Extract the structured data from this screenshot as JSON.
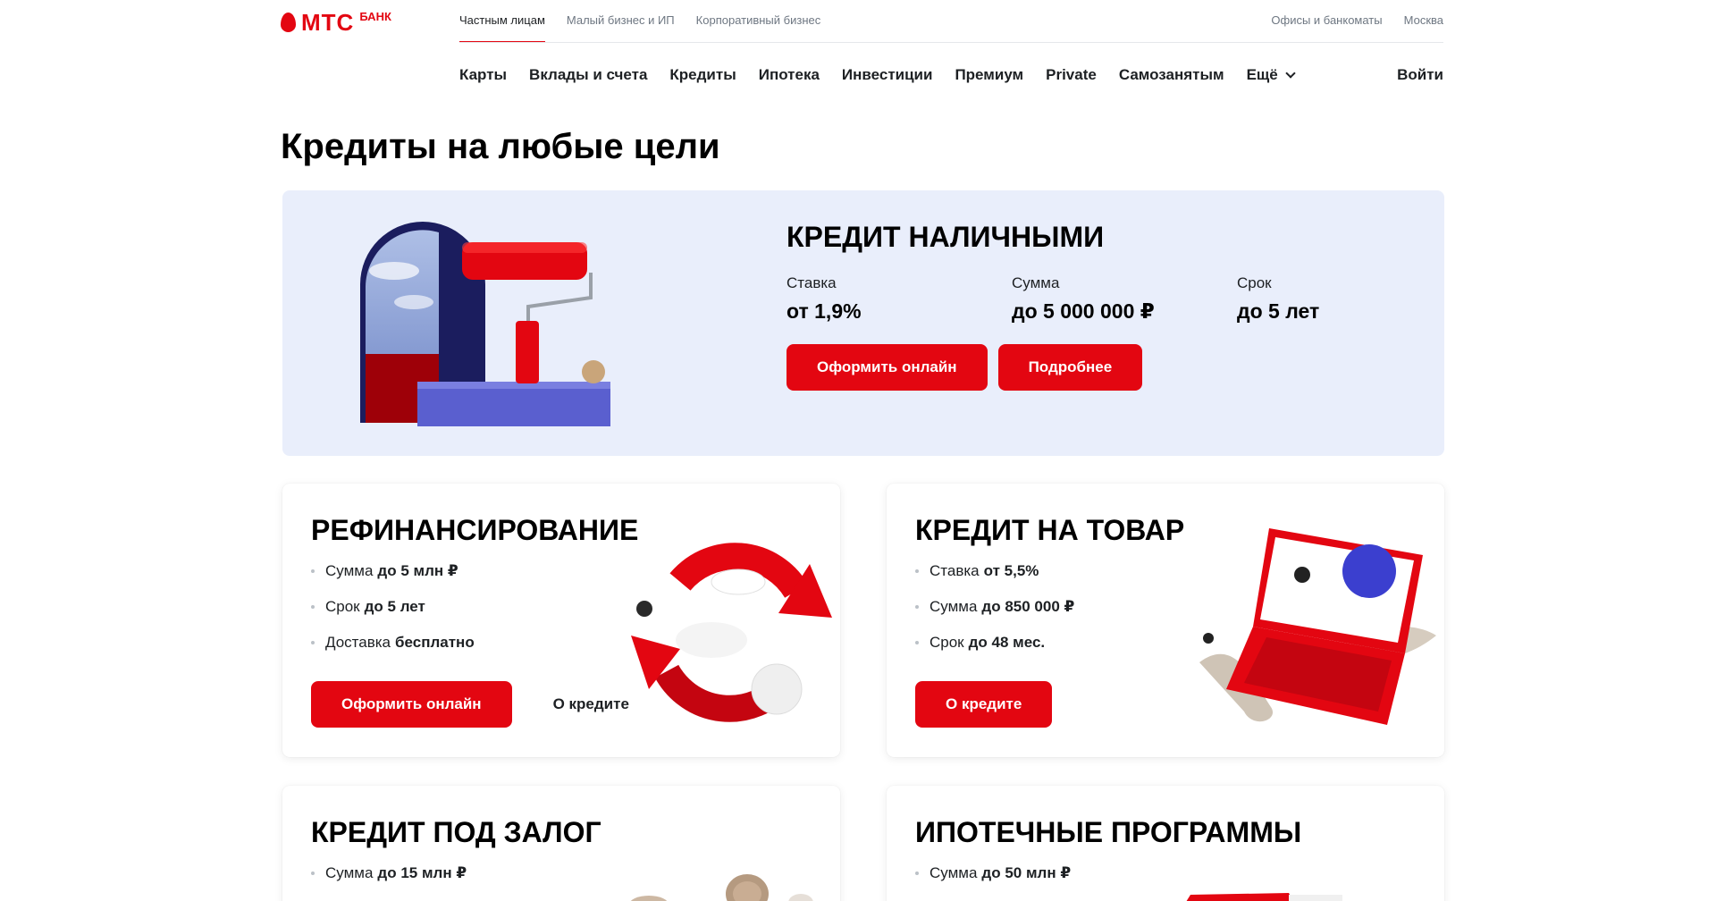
{
  "header": {
    "logo": {
      "brand": "МТС",
      "sub": "БАНК"
    },
    "segments": [
      "Частным лицам",
      "Малый бизнес и ИП",
      "Корпоративный бизнес"
    ],
    "offices": "Офисы и банкоматы",
    "city": "Москва",
    "nav": [
      "Карты",
      "Вклады и счета",
      "Кредиты",
      "Ипотека",
      "Инвестиции",
      "Премиум",
      "Private",
      "Самозанятым",
      "Ещё"
    ],
    "login": "Войти"
  },
  "page_title": "Кредиты на любые цели",
  "hero": {
    "title": "КРЕДИТ НАЛИЧНЫМИ",
    "specs": [
      {
        "label": "Ставка",
        "value": "от 1,9%"
      },
      {
        "label": "Сумма",
        "value": "до 5 000 000 ₽"
      },
      {
        "label": "Срок",
        "value": "до 5 лет"
      }
    ],
    "primary_button": "Оформить онлайн",
    "secondary_button": "Подробнее"
  },
  "cards": [
    {
      "title": "РЕФИНАНСИРОВАНИЕ",
      "items": [
        {
          "label": "Сумма",
          "value": "до 5 млн ₽"
        },
        {
          "label": "Срок",
          "value": "до 5 лет"
        },
        {
          "label": "Доставка",
          "value": "бесплатно"
        }
      ],
      "primary_button": "Оформить онлайн",
      "link_button": "О кредите"
    },
    {
      "title": "КРЕДИТ НА ТОВАР",
      "items": [
        {
          "label": "Ставка",
          "value": "от 5,5%"
        },
        {
          "label": "Сумма",
          "value": "до 850 000 ₽"
        },
        {
          "label": "Срок",
          "value": "до 48 мес."
        }
      ],
      "primary_button": "О кредите"
    },
    {
      "title": "КРЕДИТ ПОД ЗАЛОГ",
      "items": [
        {
          "label": "Сумма",
          "value": "до 15 млн ₽"
        }
      ]
    },
    {
      "title": "ИПОТЕЧНЫЕ ПРОГРАММЫ",
      "items": [
        {
          "label": "Сумма",
          "value": "до 50 млн ₽"
        }
      ]
    }
  ],
  "colors": {
    "brand_red": "#e30611",
    "hero_bg": "#e9eefb",
    "text": "#1d2023",
    "muted": "#6e7782"
  }
}
